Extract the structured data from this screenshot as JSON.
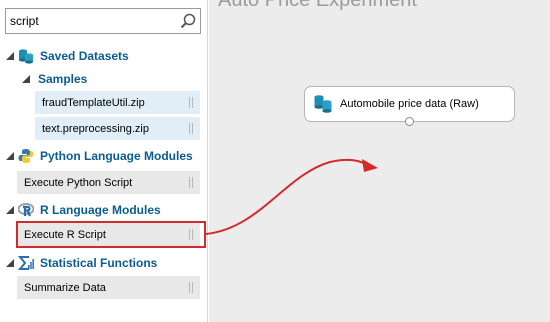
{
  "search": {
    "value": "script"
  },
  "categories": {
    "saved_datasets": "Saved Datasets",
    "samples": "Samples",
    "python": "Python Language Modules",
    "r": "R Language Modules",
    "stats": "Statistical Functions"
  },
  "items": {
    "fraud": "fraudTemplateUtil.zip",
    "text": "text.preprocessing.zip",
    "python_script": "Execute Python Script",
    "r_script": "Execute R Script",
    "summarize": "Summarize Data"
  },
  "canvas": {
    "title": "Auto Price Experiment",
    "module_label": "Automobile price data (Raw)"
  },
  "colors": {
    "category_text": "#0b5c8f",
    "dataset_icon": "#1d8fb3",
    "highlight": "#d32a2a",
    "arrow": "#d32a2a"
  },
  "icons": {
    "search": "search-icon",
    "dataset": "dataset-icon",
    "python": "python-icon",
    "r": "r-logo-icon",
    "sigma": "sigma-icon"
  }
}
